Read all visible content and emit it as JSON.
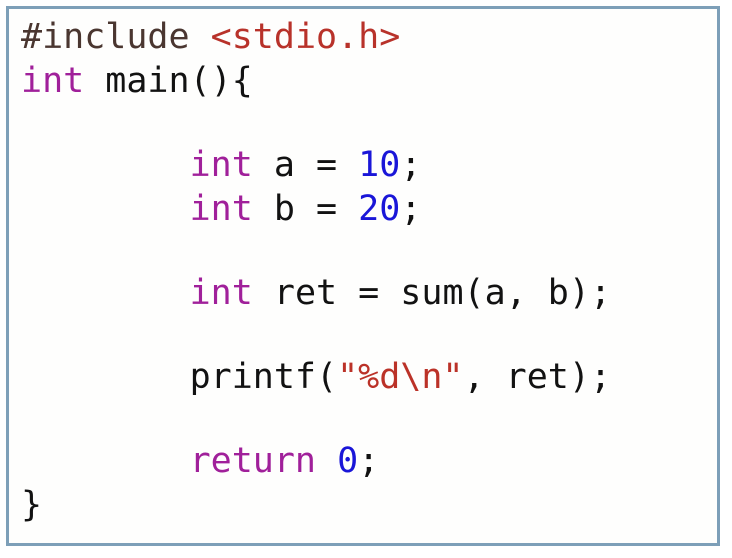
{
  "document": {
    "type": "source-code",
    "language": "C",
    "frame_border_color": "#7d9fb8",
    "background_color": "#fefefd",
    "syntax_colors": {
      "preprocessor": "#4a3630",
      "header_name": "#b8322a",
      "keyword": "#a0209a",
      "plain": "#121212",
      "number": "#1a16d8",
      "string": "#bb3228"
    },
    "code_lines": [
      {
        "index": 1,
        "text": "#include <stdio.h>",
        "tokens": [
          {
            "text": "#include ",
            "type": "preprocessor"
          },
          {
            "text": "<stdio.h>",
            "type": "header_name"
          }
        ]
      },
      {
        "index": 2,
        "text": "int main(){",
        "tokens": [
          {
            "text": "int",
            "type": "keyword"
          },
          {
            "text": " main(){",
            "type": "plain"
          }
        ]
      },
      {
        "index": 3,
        "text": "",
        "tokens": []
      },
      {
        "index": 4,
        "text": "        int a = 10;",
        "tokens": [
          {
            "text": "        ",
            "type": "plain"
          },
          {
            "text": "int",
            "type": "keyword"
          },
          {
            "text": " a = ",
            "type": "plain"
          },
          {
            "text": "10",
            "type": "number"
          },
          {
            "text": ";",
            "type": "plain"
          }
        ]
      },
      {
        "index": 5,
        "text": "        int b = 20;",
        "tokens": [
          {
            "text": "        ",
            "type": "plain"
          },
          {
            "text": "int",
            "type": "keyword"
          },
          {
            "text": " b = ",
            "type": "plain"
          },
          {
            "text": "20",
            "type": "number"
          },
          {
            "text": ";",
            "type": "plain"
          }
        ]
      },
      {
        "index": 6,
        "text": "",
        "tokens": []
      },
      {
        "index": 7,
        "text": "        int ret = sum(a, b);",
        "tokens": [
          {
            "text": "        ",
            "type": "plain"
          },
          {
            "text": "int",
            "type": "keyword"
          },
          {
            "text": " ret = sum(a, b);",
            "type": "plain"
          }
        ]
      },
      {
        "index": 8,
        "text": "",
        "tokens": []
      },
      {
        "index": 9,
        "text": "        printf(\"%d\\n\", ret);",
        "tokens": [
          {
            "text": "        printf(",
            "type": "plain"
          },
          {
            "text": "\"%d\\n\"",
            "type": "string"
          },
          {
            "text": ", ret);",
            "type": "plain"
          }
        ]
      },
      {
        "index": 10,
        "text": "",
        "tokens": []
      },
      {
        "index": 11,
        "text": "        return 0;",
        "tokens": [
          {
            "text": "        ",
            "type": "plain"
          },
          {
            "text": "return",
            "type": "keyword"
          },
          {
            "text": " ",
            "type": "plain"
          },
          {
            "text": "0",
            "type": "number"
          },
          {
            "text": ";",
            "type": "plain"
          }
        ]
      },
      {
        "index": 12,
        "text": "}",
        "tokens": [
          {
            "text": "}",
            "type": "plain"
          }
        ]
      }
    ]
  }
}
